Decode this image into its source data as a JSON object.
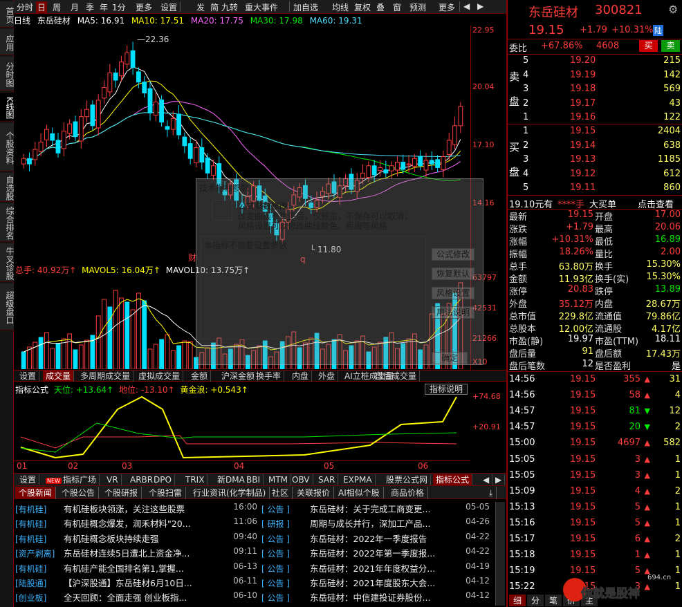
{
  "left_tabs": [
    "首页",
    "应用",
    "分时图",
    "K线图",
    "个股资料",
    "自选股",
    "综合排名",
    "牛叉诊股",
    "超级盘口"
  ],
  "toolbar": [
    "分时",
    "日",
    "周",
    "月",
    "季",
    "年",
    "1分",
    "更多",
    "设置",
    "发",
    "简",
    "九转",
    "重大事件",
    "加自选",
    "均线",
    "复权",
    "叠",
    "窗",
    "预测",
    "更多"
  ],
  "info": {
    "period": "日线",
    "name": "东岳硅材",
    "ma5": "MA5: 16.91",
    "ma10": "MA10: 17.51",
    "ma20": "MA20: 17.75",
    "ma30": "MA30: 17.98",
    "ma60": "MA60: 19.31"
  },
  "price_axis": [
    "22.95",
    "20.04",
    "17.10",
    "14.16"
  ],
  "chart_labels": {
    "high": "22.36",
    "low": "11.80",
    "mark_low": "q",
    "mark_cai": "财"
  },
  "volume": {
    "head_total": "总手: 40.92万↑",
    "mavol5": "MAVOL5: 16.04万↑",
    "mavol10": "MAVOL10: 13.75万↑",
    "axis": [
      "63797",
      "42531",
      "21266",
      "X10"
    ]
  },
  "indicator_tabs": [
    "设置",
    "成交量",
    "多周期成交量",
    "虚拟成交量",
    "金额",
    "沪深金额",
    "换手率",
    "内盘",
    "外盘",
    "AI立桩成交量",
    "盘后成交量"
  ],
  "macd": {
    "name": "指标公式",
    "tian": "天位: +13.64↑",
    "di": "地位: -13.10↑",
    "huang": "黄金浪: +0.543↑",
    "axis": [
      "+74.68",
      "+20.91"
    ],
    "button": "指标说明"
  },
  "x_axis": [
    "01",
    "02",
    "03",
    "04",
    "05",
    "06"
  ],
  "formula_tabs": [
    "设置",
    "指标广场",
    "VR",
    "ARBR",
    "DPO",
    "TRIX",
    "新DMA",
    "BBI",
    "MTM",
    "OBV",
    "SAR",
    "EXPMA",
    "股票公式网",
    "指标公式"
  ],
  "formula_new_badge": "NEW",
  "news_tabs": [
    "个股新闻",
    "个股公告",
    "个股研报",
    "个股扫雷",
    "行业资讯(化学制品)",
    "社区",
    "关联报价",
    "AI相似个股",
    "商品价格"
  ],
  "news_left": [
    {
      "tag": "[有机硅]",
      "title": "有机硅板块领涨，关注这些股票",
      "date": "16:00"
    },
    {
      "tag": "[有机硅]",
      "title": "有机硅概念爆发，润禾材料\"20...",
      "date": "11:06"
    },
    {
      "tag": "[有机硅]",
      "title": "有机硅概念板块持续走强",
      "date": "09:40"
    },
    {
      "tag": "[资产剥离]",
      "title": "东岳硅材连续5日遭北上资金净...",
      "date": "09:11"
    },
    {
      "tag": "[有机硅]",
      "title": "有机硅产能全国排名第1,掌握...",
      "date": "06-13"
    },
    {
      "tag": "[陆股通]",
      "title": "【沪深股通】东岳硅材6月10日...",
      "date": "06-11"
    },
    {
      "tag": "[创业板]",
      "title": "全天回顾：全面走强 创业板指...",
      "date": "06-10"
    }
  ],
  "news_right": [
    {
      "tag": "[  公告  ]",
      "title": "东岳硅材：关于完成工商变更...",
      "date": "05-05"
    },
    {
      "tag": "[  研报  ]",
      "title": "周期与成长并行，深加工产品...",
      "date": "04-26"
    },
    {
      "tag": "[  公告  ]",
      "title": "东岳硅材：2022年一季度报告",
      "date": "04-22"
    },
    {
      "tag": "[  公告  ]",
      "title": "东岳硅材：2022年第一季度报...",
      "date": "04-22"
    },
    {
      "tag": "[  公告  ]",
      "title": "东岳硅材：2021年年度权益分...",
      "date": "04-19"
    },
    {
      "tag": "[  公告  ]",
      "title": "东岳硅材：2021年度股东大会...",
      "date": "04-12"
    },
    {
      "tag": "[  公告  ]",
      "title": "东岳硅材：中信建投证券股份...",
      "date": "04-12"
    }
  ],
  "quote": {
    "name": "东岳硅材",
    "code": "300821",
    "price": "19.15",
    "change": "+1.79",
    "pct": "+10.31%",
    "market": "陆",
    "weibi_label": "委比",
    "weibi": "+67.86%",
    "weicha": "4608",
    "buy_btn": "买",
    "sell_btn": "卖",
    "sell_label": [
      "卖",
      "盘"
    ],
    "buy_label": [
      "买",
      "盘"
    ],
    "asks": [
      [
        "5",
        "19.20",
        "215"
      ],
      [
        "4",
        "19.19",
        "142"
      ],
      [
        "3",
        "19.18",
        "569"
      ],
      [
        "2",
        "19.17",
        "43"
      ],
      [
        "1",
        "19.16",
        "122"
      ]
    ],
    "bids": [
      [
        "1",
        "19.15",
        "2404"
      ],
      [
        "2",
        "19.14",
        "638"
      ],
      [
        "3",
        "19.13",
        "1185"
      ],
      [
        "4",
        "19.12",
        "612"
      ],
      [
        "5",
        "19.11",
        "860"
      ]
    ],
    "big_order": [
      "19.10元有",
      "****手",
      "大买单",
      "点击查看"
    ],
    "stats": [
      [
        "最新",
        "19.15",
        "开盘",
        "17.00"
      ],
      [
        "涨跌",
        "+1.79",
        "最高",
        "20.06"
      ],
      [
        "涨幅",
        "+10.31%",
        "最低",
        "16.89"
      ],
      [
        "振幅",
        "18.26%",
        "量比",
        "2.00"
      ],
      [
        "总手",
        "63.80万",
        "换手",
        "15.30%"
      ],
      [
        "金额",
        "11.93亿",
        "换手(实)",
        "15.30%"
      ],
      [
        "涨停",
        "20.83",
        "跌停",
        "13.89"
      ],
      [
        "外盘",
        "35.12万",
        "内盘",
        "28.67万"
      ],
      [
        "总市值",
        "229.8亿",
        "流通值",
        "79.86亿"
      ],
      [
        "总股本",
        "12.00亿",
        "流通股",
        "4.17亿"
      ],
      [
        "市盈(静)",
        "19.97",
        "市盈(TTM)",
        "18.11"
      ],
      [
        "盘后量",
        "91",
        "盘后额",
        "17.43万"
      ],
      [
        "盘后笔数",
        "12",
        "是否盈利",
        "是"
      ]
    ],
    "ticks": [
      [
        "14:56",
        "19.15",
        "355",
        "31",
        "up"
      ],
      [
        "14:56",
        "19.15",
        "58",
        "4",
        "up"
      ],
      [
        "14:57",
        "19.15",
        "81",
        "12",
        "down"
      ],
      [
        "14:57",
        "19.15",
        "20",
        "2",
        "down"
      ],
      [
        "15:00",
        "19.15",
        "4697",
        "582",
        "up"
      ],
      [
        "15:05",
        "19.15",
        "3",
        "1",
        "up"
      ],
      [
        "15:05",
        "19.15",
        "3",
        "1",
        "up"
      ],
      [
        "15:09",
        "19.15",
        "4",
        "2",
        "up"
      ],
      [
        "15:13",
        "19.15",
        "5",
        "1",
        "up"
      ],
      [
        "15:16",
        "19.15",
        "5",
        "1",
        "up"
      ],
      [
        "15:17",
        "19.15",
        "6",
        "2",
        "up"
      ],
      [
        "15:18",
        "19.15",
        "1",
        "1",
        "up"
      ],
      [
        "15:19",
        "19.15",
        "5",
        "1",
        "up"
      ],
      [
        "15:22",
        "19.15",
        "3",
        "1",
        "up"
      ]
    ],
    "bottom_tabs": [
      "细",
      "分",
      "笔",
      "价",
      "主"
    ]
  },
  "dialog": {
    "title": "技术指标参数",
    "heading": "公式参数修改",
    "line1": "改变曲线参数值后，仅预览，不保存可以取消；",
    "line2": "风格设置可以修改曲线颜色、粗细等风格",
    "note": "本指标不需要设置参数",
    "btn1": "公式修改",
    "btn2": "恢复默认",
    "btn3": "风格设置",
    "btn4": "用法说明",
    "btn5": "确定"
  },
  "watermark": "你就是股神",
  "watermark_url": "694.cn",
  "colors": {
    "up": "#ff3c3c",
    "down": "#00e0ff",
    "bg": "#000000",
    "accent": "#7a0000"
  }
}
